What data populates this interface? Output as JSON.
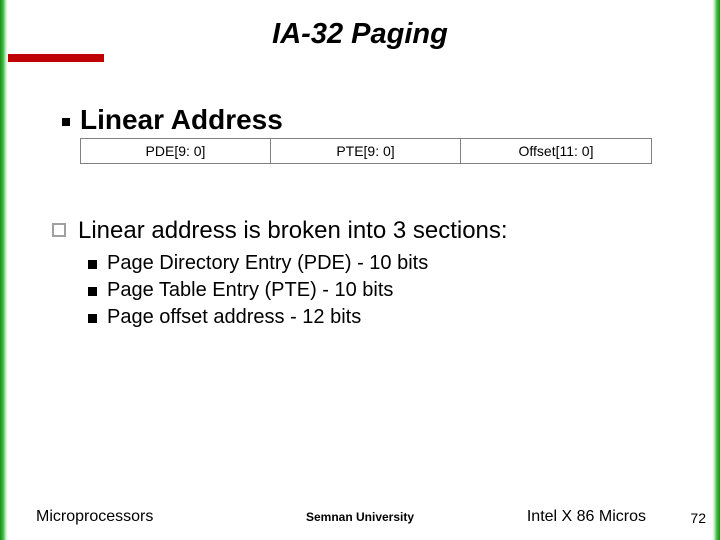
{
  "title": "IA-32 Paging",
  "diagram_heading": "Linear Address",
  "table": {
    "cells": [
      "PDE[9: 0]",
      "PTE[9: 0]",
      "Offset[11: 0]"
    ]
  },
  "main_bullet": "Linear address is broken into 3 sections:",
  "sub_bullets": [
    "Page Directory Entry (PDE) - 10 bits",
    "Page Table Entry (PTE) - 10 bits",
    "Page offset address - 12 bits"
  ],
  "footer": {
    "left": "Microprocessors",
    "center": "Semnan University",
    "right": "Intel X 86 Micros",
    "page": "72"
  }
}
